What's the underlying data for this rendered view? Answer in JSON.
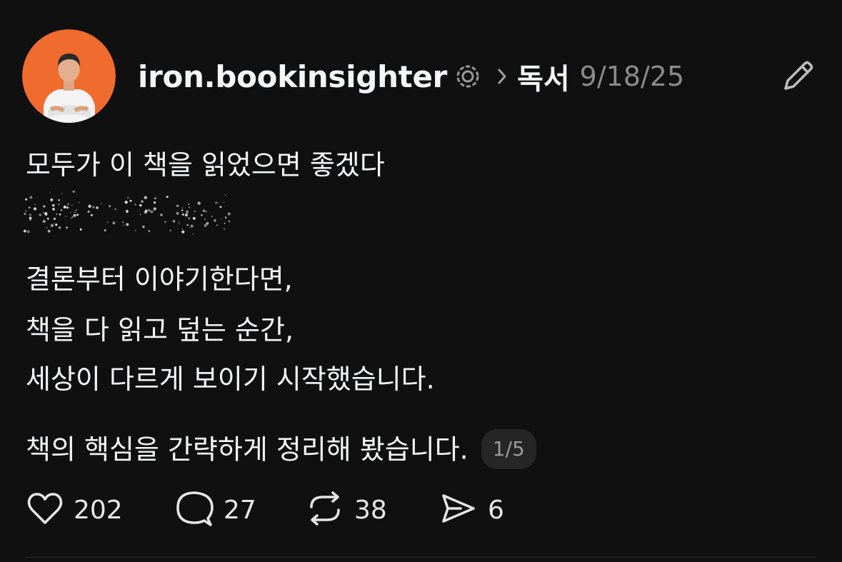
{
  "post": {
    "username": "iron.bookinsighter",
    "topic": "독서",
    "timestamp": "9/18/25",
    "lines": [
      "모두가 이 책을 읽었으면 좋겠다",
      "결론부터 이야기한다면,",
      "책을 다 읽고 덮는 순간,",
      "세상이 다르게 보이기 시작했습니다.",
      "책의 핵심을 간략하게 정리해 봤습니다."
    ],
    "page_indicator": "1/5"
  },
  "actions": {
    "likes": "202",
    "comments": "27",
    "reposts": "38",
    "shares": "6"
  },
  "colors": {
    "background": "#101010",
    "text": "#f3f5f7",
    "muted": "#8a8a8a",
    "avatar_bg": "#f06b2e"
  },
  "icons": [
    "verified-icon",
    "chevron-right-icon",
    "edit-icon",
    "heart-icon",
    "comment-icon",
    "repost-icon",
    "share-icon"
  ]
}
